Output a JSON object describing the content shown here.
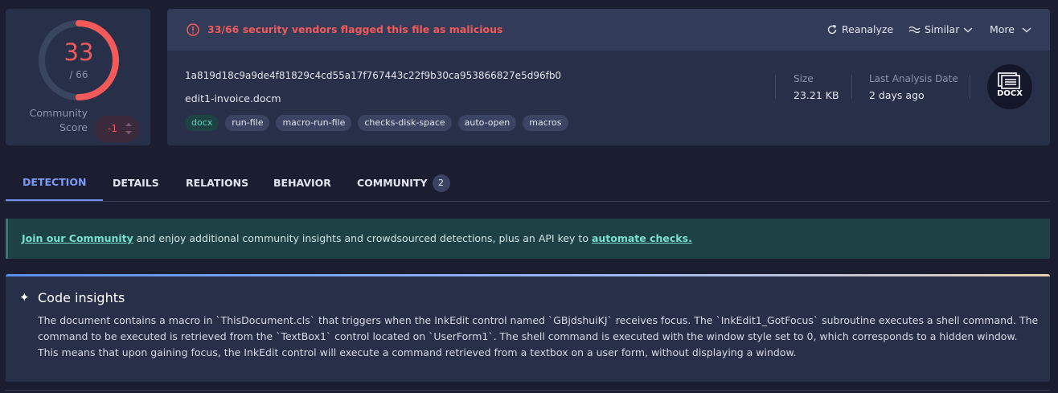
{
  "score": {
    "positives": "33",
    "total": "/ 66",
    "positives_value": 33,
    "total_value": 66
  },
  "community_score": {
    "label_line1": "Community",
    "label_line2": "Score",
    "value": "-1"
  },
  "alert": {
    "text": "33/66 security vendors flagged this file as malicious"
  },
  "actions": {
    "reanalyze": "Reanalyze",
    "similar": "Similar",
    "more": "More"
  },
  "file": {
    "hash": "1a819d18c9a9de4f81829c4cd55a17f767443c22f9b30ca953866827e5d96fb0",
    "name": "edit1-invoice.docm",
    "tags": [
      "docx",
      "run-file",
      "macro-run-file",
      "checks-disk-space",
      "auto-open",
      "macros"
    ],
    "size_label": "Size",
    "size_value": "23.21 KB",
    "date_label": "Last Analysis Date",
    "date_value": "2 days ago",
    "type": "DOCX"
  },
  "tabs": [
    {
      "label": "DETECTION",
      "active": true
    },
    {
      "label": "DETAILS"
    },
    {
      "label": "RELATIONS"
    },
    {
      "label": "BEHAVIOR"
    },
    {
      "label": "COMMUNITY",
      "badge": "2"
    }
  ],
  "banner": {
    "link1": "Join our Community",
    "middle": " and enjoy additional community insights and crowdsourced detections, plus an API key to ",
    "link2": "automate checks."
  },
  "insights": {
    "icon": "sparkle-icon",
    "title": "Code insights",
    "body": "The document contains a macro in `ThisDocument.cls` that triggers when the InkEdit control named `GBjdshuiKJ` receives focus. The `InkEdit1_GotFocus` subroutine executes a shell command. The command to be executed is retrieved from the `TextBox1` control located on `UserForm1`. The shell command is executed with the window style set to 0, which corresponds to a hidden window. This means that upon gaining focus, the InkEdit control will execute a command retrieved from a textbox on a user form, without displaying a window."
  },
  "colors": {
    "malicious": "#f25a5a",
    "accent": "#6f8ff5",
    "card": "#283049",
    "background": "#1b1d30"
  }
}
